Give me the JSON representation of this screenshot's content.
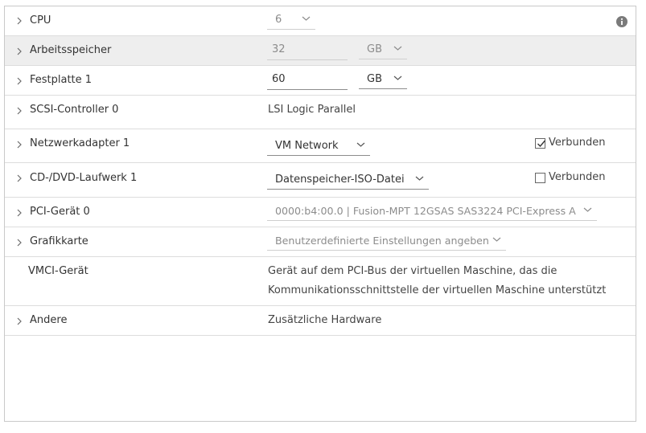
{
  "rows": {
    "cpu": {
      "label": "CPU",
      "value": "6"
    },
    "memory": {
      "label": "Arbeitsspeicher",
      "value": "32",
      "unit": "GB"
    },
    "disk": {
      "label": "Festplatte 1",
      "value": "60",
      "unit": "GB"
    },
    "scsi": {
      "label": "SCSI-Controller 0",
      "value": "LSI Logic Parallel"
    },
    "network": {
      "label": "Netzwerkadapter 1",
      "value": "VM Network",
      "connected_label": "Verbunden",
      "connected": true
    },
    "cddvd": {
      "label": "CD-/DVD-Laufwerk 1",
      "value": "Datenspeicher-ISO-Datei",
      "connected_label": "Verbunden",
      "connected": false
    },
    "pci": {
      "label": "PCI-Gerät 0",
      "value": "0000:b4:00.0 | Fusion-MPT 12GSAS SAS3224 PCI-Express A"
    },
    "graphics": {
      "label": "Grafikkarte",
      "value": "Benutzerdefinierte Einstellungen angeben"
    },
    "vmci": {
      "label": "VMCI-Gerät",
      "line1": "Gerät auf dem PCI-Bus der virtuellen Maschine, das die",
      "line2": "Kommunikationsschnittstelle der virtuellen Maschine unterstützt"
    },
    "other": {
      "label": "Andere",
      "value": "Zusätzliche Hardware"
    }
  },
  "colors": {
    "border": "#dddddd",
    "highlight": "#eeeeee",
    "text": "#333333",
    "disabled": "#8c8c8c"
  },
  "icons": {
    "expand": "chevron-right-icon",
    "dropdown": "chevron-down-icon",
    "info": "info-icon",
    "checkbox": "checkbox-icon"
  }
}
